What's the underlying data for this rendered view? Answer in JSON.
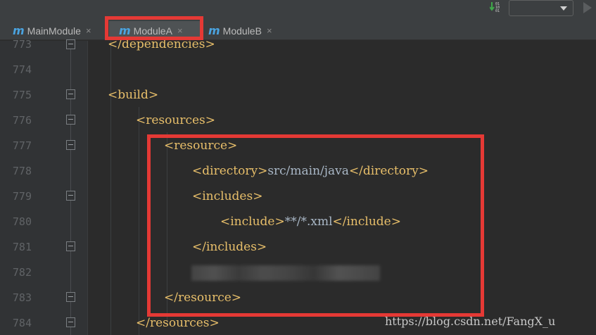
{
  "toolbar": {
    "vcs_icon": "git-update-icon",
    "run_icon": "play-icon"
  },
  "tabs": [
    {
      "label": "MainModule",
      "icon": "maven-m-icon",
      "active": false
    },
    {
      "label": "ModuleA",
      "icon": "maven-m-icon",
      "active": true
    },
    {
      "label": "ModuleB",
      "icon": "maven-m-icon",
      "active": false
    }
  ],
  "tab_icon_glyph": "m",
  "close_glyph": "×",
  "line_numbers": [
    "773",
    "774",
    "775",
    "776",
    "777",
    "778",
    "779",
    "780",
    "781",
    "782",
    "783",
    "784"
  ],
  "code_lines": [
    {
      "text": "</dependencies>"
    },
    {
      "text": ""
    },
    {
      "text": "<build>"
    },
    {
      "text": "<resources>"
    },
    {
      "text": "<resource>"
    },
    {
      "text": "<directory>src/main/java</directory>"
    },
    {
      "text": "<includes>"
    },
    {
      "text": "<include>**/*.xml</include>"
    },
    {
      "text": "</includes>"
    },
    {
      "text": ""
    },
    {
      "text": "</resource>"
    },
    {
      "text": "</resources>"
    }
  ],
  "code_parts": {
    "dependencies_close": "</dependencies>",
    "build_open": "<build>",
    "resources_open": "<resources>",
    "resource_open": "<resource>",
    "directory_open": "<directory>",
    "directory_value": "src/main/java",
    "directory_close": "</directory>",
    "includes_open": "<includes>",
    "include_open": "<include>",
    "include_value": "**/*.xml",
    "include_close": "</include>",
    "includes_close": "</includes>",
    "resource_close": "</resource>",
    "resources_close": "</resources>"
  },
  "watermark": "https://blog.csdn.net/FangX_u",
  "colors": {
    "highlight": "#e53935",
    "tag": "#e8bf6a",
    "text": "#a9b7c6"
  }
}
